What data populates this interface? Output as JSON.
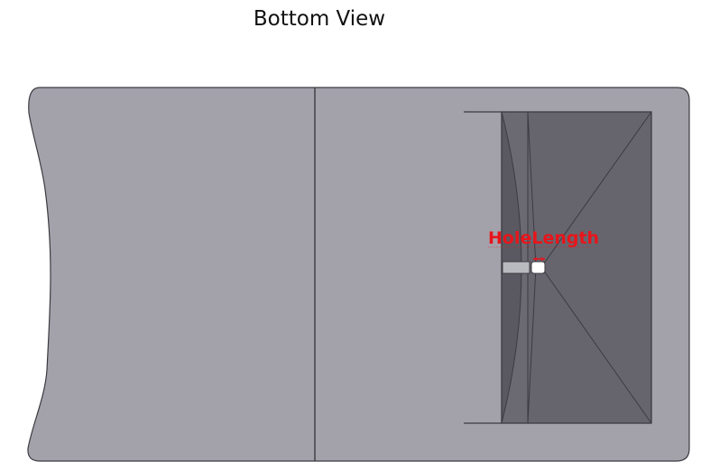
{
  "view": {
    "title": "Bottom View"
  },
  "dimension": {
    "label": "HoleLength"
  },
  "colors": {
    "part_body": "#a3a2ab",
    "part_edge": "#3b3b40",
    "pocket_floor": "#66656e",
    "pocket_wall_dark": "#5a5961",
    "pocket_wall_light": "#77767f",
    "hole_slot": "#b9b9c0",
    "dimension_text": "#e8151b",
    "background": "#ffffff"
  }
}
